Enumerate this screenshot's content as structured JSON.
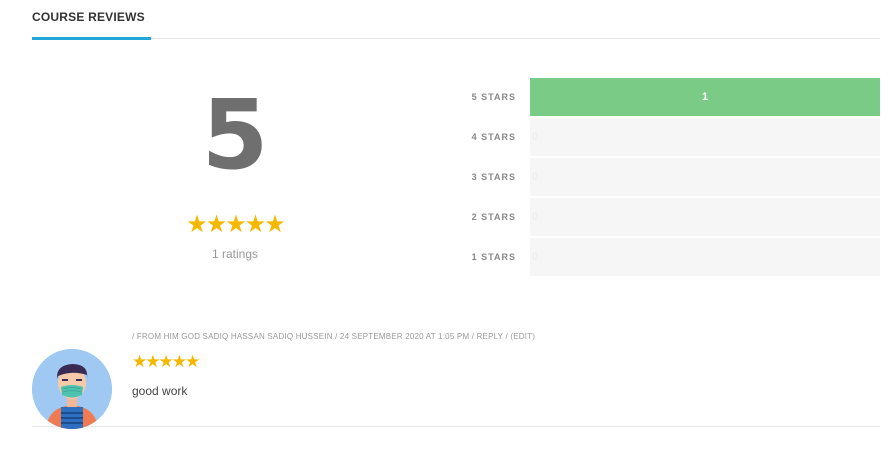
{
  "header": {
    "title": "COURSE REVIEWS"
  },
  "summary": {
    "average": "5",
    "stars": "★★★★★",
    "rating": 5,
    "ratings_label": "1 ratings"
  },
  "colors": {
    "accent": "#1ea7d8",
    "star": "#f5b800",
    "bar_fill": "#7acb85",
    "bar_track": "#f6f6f6"
  },
  "breakdown": [
    {
      "label": "5 STARS",
      "count": "1",
      "fraction": 1.0
    },
    {
      "label": "4 STARS",
      "count": "0",
      "fraction": 0
    },
    {
      "label": "3 STARS",
      "count": "0",
      "fraction": 0
    },
    {
      "label": "2 STARS",
      "count": "0",
      "fraction": 0
    },
    {
      "label": "1 STARS",
      "count": "0",
      "fraction": 0
    }
  ],
  "review": {
    "meta": "/ FROM HIM GOD SADIQ HASSAN SADIQ HUSSEIN / 24 SEPTEMBER 2020 AT 1:05 PM / REPLY / (EDIT)",
    "stars": "★★★★★",
    "rating": 5,
    "text": "good work",
    "avatar_icon": "user-avatar-masked-person"
  }
}
